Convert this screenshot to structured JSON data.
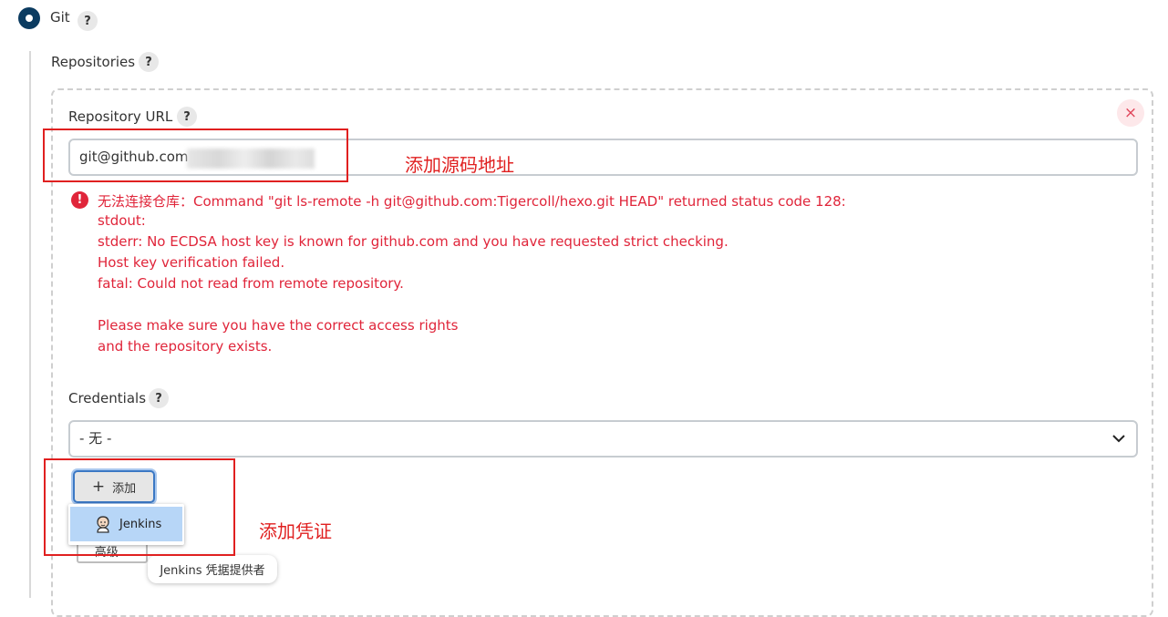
{
  "scm": {
    "option_label": "Git",
    "help_glyph": "?"
  },
  "repositories": {
    "label": "Repositories",
    "repo_url_label": "Repository URL",
    "repo_url_value": "git@github.com",
    "remove_glyph": "×",
    "error_lines": [
      "无法连接仓库：Command \"git ls-remote -h git@github.com:Tigercoll/hexo.git HEAD\" returned status code 128:",
      "stdout:",
      "stderr: No ECDSA host key is known for github.com and you have requested strict checking.",
      "Host key verification failed.",
      "fatal: Could not read from remote repository.",
      "",
      "Please make sure you have the correct access rights",
      "and the repository exists."
    ],
    "error_icon_glyph": "!"
  },
  "credentials": {
    "label": "Credentials",
    "selected": "- 无 -",
    "add_label": "添加",
    "add_glyph": "+",
    "dropdown_items": [
      "Jenkins"
    ],
    "advanced_label": "高级...",
    "tooltip": "Jenkins 凭据提供者"
  },
  "annotations": {
    "repo": "添加源码地址",
    "credentials": "添加凭证",
    "color": "#e02020"
  },
  "colors": {
    "radio": "#0b3b60",
    "error": "#e0253a",
    "focus": "#3b78c4",
    "dropdown_highlight": "#b7d6f7"
  },
  "icons": [
    "radio-selected-icon",
    "help-icon",
    "close-icon",
    "error-icon",
    "chevron-down-icon",
    "plus-icon",
    "jenkins-icon"
  ]
}
